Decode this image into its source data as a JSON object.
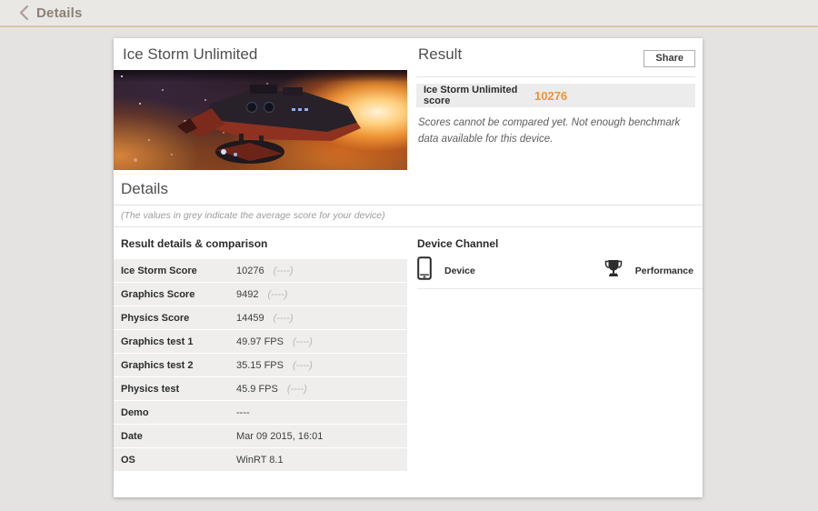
{
  "topbar": {
    "title": "Details"
  },
  "left_panel": {
    "title": "Ice Storm Unlimited"
  },
  "result_panel": {
    "title": "Result",
    "share_button": "Share",
    "score_label": "Ice Storm Unlimited score",
    "score_value": "10276",
    "note": "Scores cannot be compared yet. Not enough benchmark data available for this device."
  },
  "details_section": {
    "title": "Details",
    "grey_note": "(The values in grey indicate the average score for your device)",
    "table_title": "Result details & comparison",
    "rows": [
      {
        "label": "Ice Storm Score",
        "value": "10276",
        "average": "(----)"
      },
      {
        "label": "Graphics Score",
        "value": "9492",
        "average": "(----)"
      },
      {
        "label": "Physics Score",
        "value": "14459",
        "average": "(----)"
      },
      {
        "label": "Graphics test 1",
        "value": "49.97 FPS",
        "average": "(----)"
      },
      {
        "label": "Graphics test 2",
        "value": "35.15 FPS",
        "average": "(----)"
      },
      {
        "label": "Physics test",
        "value": "45.9 FPS",
        "average": "(----)"
      },
      {
        "label": "Demo",
        "value": "----",
        "average": ""
      },
      {
        "label": "Date",
        "value": "Mar 09 2015, 16:01",
        "average": ""
      },
      {
        "label": "OS",
        "value": "WinRT 8.1",
        "average": ""
      }
    ]
  },
  "device_channel": {
    "title": "Device Channel",
    "device_label": "Device",
    "performance_label": "Performance"
  },
  "colors": {
    "accent_orange": "#ee9434",
    "topbar_line": "#d9c3a7",
    "page_background": "#e5e3e1"
  }
}
